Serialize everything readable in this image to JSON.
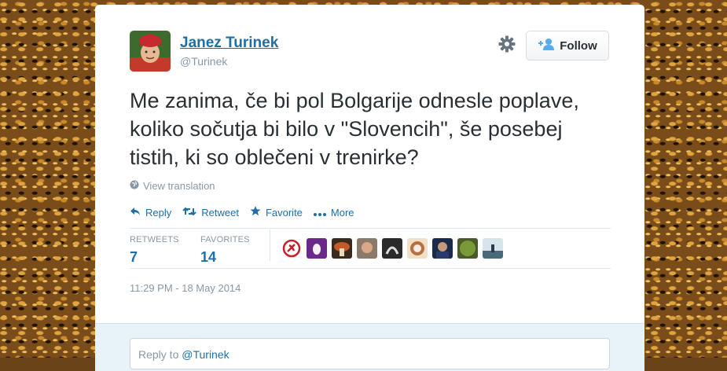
{
  "user": {
    "name": "Janez Turinek",
    "handle": "@Turinek"
  },
  "follow_label": "Follow",
  "tweet": {
    "text": "Me zanima, če bi pol Bolgarije odnesle poplave, koliko sočutja bi bilo v \"Slovencih\", še posebej tistih, ki so oblečeni v trenirke?",
    "translate_label": "View translation",
    "timestamp": "11:29 PM - 18 May 2014"
  },
  "actions": {
    "reply": "Reply",
    "retweet": "Retweet",
    "favorite": "Favorite",
    "more": "More"
  },
  "stats": {
    "retweets_label": "RETWEETS",
    "retweets_count": "7",
    "favorites_label": "FAVORITES",
    "favorites_count": "14"
  },
  "reply": {
    "prefix": "Reply to ",
    "mention": "@Turinek"
  },
  "colors": {
    "link": "#1f6fa6",
    "muted": "#8899a6",
    "text": "#292f33"
  },
  "icons": {
    "settings": "gear-icon",
    "follow": "add-person-icon",
    "translate": "globe-icon",
    "reply": "reply-arrow-icon",
    "retweet": "retweet-icon",
    "favorite": "star-icon",
    "more": "more-dots-icon"
  }
}
